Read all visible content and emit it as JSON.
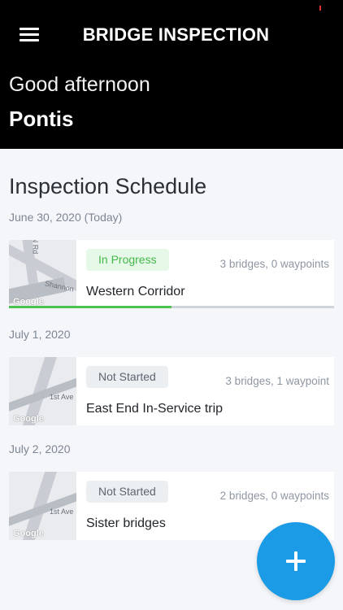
{
  "header": {
    "title": "BRIDGE INSPECTION",
    "greeting": "Good afternoon",
    "user_name": "Pontis"
  },
  "schedule": {
    "title": "Inspection Schedule",
    "groups": [
      {
        "date": "June 30, 2020 (Today)",
        "trip": {
          "status": "In Progress",
          "counts": "3 bridges, 0 waypoints",
          "name": "Western Corridor",
          "progress": 0.5,
          "map_labels": [
            "N Rd",
            "Shannon"
          ]
        }
      },
      {
        "date": "July 1, 2020",
        "trip": {
          "status": "Not Started",
          "counts": "3 bridges, 1 waypoint",
          "name": "East End In-Service trip",
          "map_labels": [
            "1st Ave"
          ]
        }
      },
      {
        "date": "July 2, 2020",
        "trip": {
          "status": "Not Started",
          "counts": "2 bridges, 0 waypoints",
          "name": "Sister bridges",
          "map_labels": [
            "1st Ave"
          ]
        }
      }
    ]
  },
  "map_attribution": "Google",
  "icons": {
    "menu": "hamburger-menu-icon",
    "add": "plus-icon"
  },
  "colors": {
    "accent": "#1b9be6",
    "in_progress": "#44b84a",
    "header_bg": "#000000"
  }
}
